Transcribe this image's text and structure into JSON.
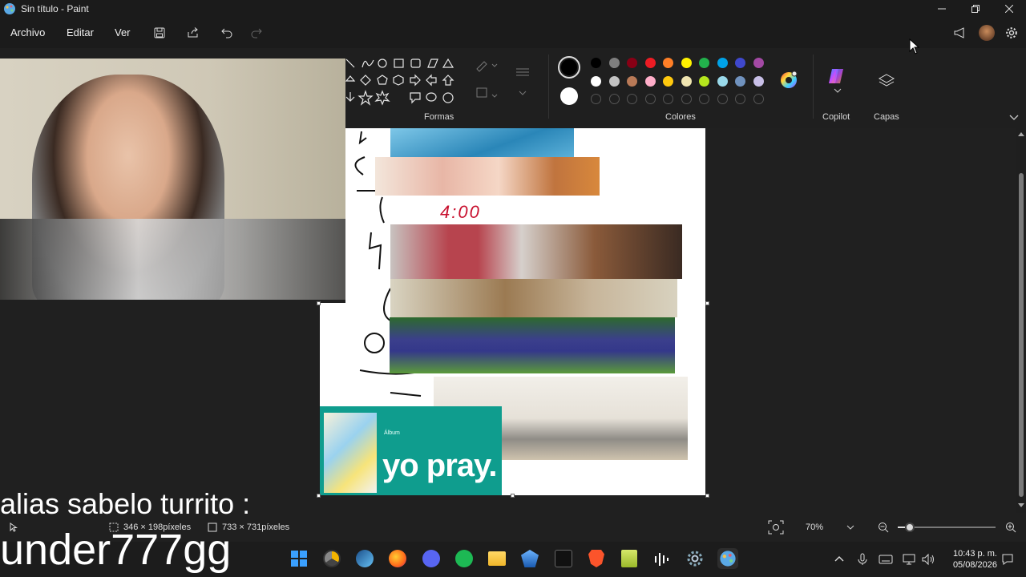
{
  "window": {
    "title": "Sin título - Paint",
    "controls": [
      "minimize",
      "restore",
      "close"
    ]
  },
  "menu": {
    "items": [
      "Archivo",
      "Editar",
      "Ver"
    ]
  },
  "toolbar_icons": [
    "save-icon",
    "share-icon",
    "undo-icon",
    "redo-icon"
  ],
  "header_right_icons": [
    "announcement-icon",
    "profile-avatar",
    "settings-icon"
  ],
  "ribbon": {
    "shapes_label": "Formas",
    "colors_label": "Colores",
    "copilot_label": "Copilot",
    "layers_label": "Capas",
    "primary_color": "#000000",
    "secondary_color": "#ffffff",
    "palette_row1": [
      "#000000",
      "#7f7f7f",
      "#880015",
      "#ed1c24",
      "#ff7f27",
      "#fff200",
      "#22b14c",
      "#00a2e8",
      "#3f48cc",
      "#a349a4"
    ],
    "palette_row2": [
      "#ffffff",
      "#c3c3c3",
      "#b97a57",
      "#ffaec9",
      "#ffc90e",
      "#efe4b0",
      "#b5e61d",
      "#99d9ea",
      "#7092be",
      "#c8bfe7"
    ]
  },
  "canvas": {
    "doodle_text": "4:00",
    "album_tag": "Álbum",
    "album_title": "yo pray."
  },
  "status": {
    "selection_size": "346 × 198píxeles",
    "canvas_size": "733 × 731píxeles",
    "zoom": "70%"
  },
  "overlay": {
    "line1": "alias sabelo turrito :",
    "line2": "under777gg"
  },
  "taskbar": {
    "apps": [
      "windows-start",
      "chrome-canary",
      "steam",
      "firefox",
      "discord",
      "spotify",
      "file-explorer",
      "rocket-league",
      "ff-app",
      "brave",
      "notepad",
      "audio-app",
      "settings",
      "paint"
    ],
    "time": "10:43 p. m.",
    "date": "05/08/2026"
  }
}
